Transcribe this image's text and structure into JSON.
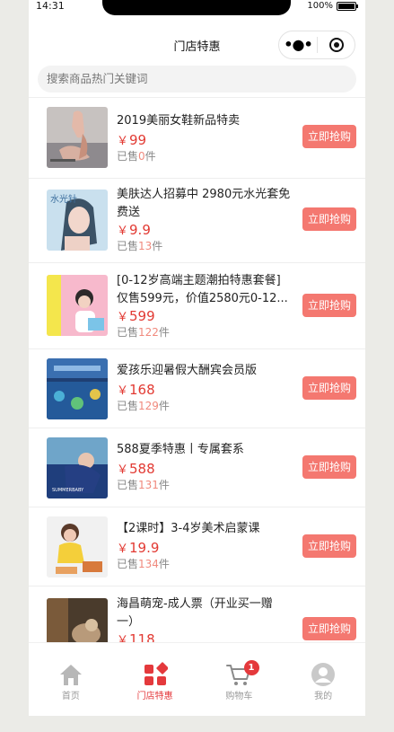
{
  "status": {
    "time": "14:31",
    "battery": "100%"
  },
  "nav": {
    "title": "门店特惠",
    "more_icon": "more-dots-icon",
    "close_icon": "close-target-icon"
  },
  "search": {
    "placeholder": "搜索商品热门关键词"
  },
  "items": [
    {
      "title_lines": [
        "2019美丽女鞋新品特卖",
        ""
      ],
      "currency": "￥",
      "price": "99",
      "sold_prefix": "已售",
      "sold": "0",
      "sold_suffix": "件",
      "button": "立即抢购"
    },
    {
      "title_lines": [
        "美肤达人招募中 2980元水光套免",
        "费送"
      ],
      "currency": "￥",
      "price": "9.9",
      "sold_prefix": "已售",
      "sold": "13",
      "sold_suffix": "件",
      "button": "立即抢购"
    },
    {
      "title_lines": [
        "[0-12岁高端主题潮拍特惠套餐]",
        "仅售599元，价值2580元0-12..."
      ],
      "currency": "￥",
      "price": "599",
      "sold_prefix": "已售",
      "sold": "122",
      "sold_suffix": "件",
      "button": "立即抢购"
    },
    {
      "title_lines": [
        "爱孩乐迎暑假大酬宾会员版",
        ""
      ],
      "currency": "￥",
      "price": "168",
      "sold_prefix": "已售",
      "sold": "129",
      "sold_suffix": "件",
      "button": "立即抢购"
    },
    {
      "title_lines": [
        "588夏季特惠丨专属套系",
        ""
      ],
      "currency": "￥",
      "price": "588",
      "sold_prefix": "已售",
      "sold": "131",
      "sold_suffix": "件",
      "button": "立即抢购"
    },
    {
      "title_lines": [
        "【2课时】3-4岁美术启蒙课",
        ""
      ],
      "currency": "￥",
      "price": "19.9",
      "sold_prefix": "已售",
      "sold": "134",
      "sold_suffix": "件",
      "button": "立即抢购"
    },
    {
      "title_lines": [
        " 海昌萌宠-成人票（开业买一赠",
        "一）"
      ],
      "currency": "￥",
      "price": "118",
      "sold_prefix": "已售",
      "sold": "",
      "sold_suffix": "",
      "button": "立即抢购"
    }
  ],
  "thumb_text": {
    "item2": "水光针",
    "item5": "SUMMERBABY"
  },
  "tabbar": {
    "tabs": [
      {
        "label": "首页",
        "icon": "home-icon"
      },
      {
        "label": "门店特惠",
        "icon": "store-deals-icon",
        "active": true
      },
      {
        "label": "购物车",
        "icon": "cart-icon",
        "badge": "1"
      },
      {
        "label": "我的",
        "icon": "user-icon"
      }
    ]
  },
  "colors": {
    "accent": "#e4393c",
    "button": "#f47870",
    "price": "#e23a33"
  }
}
